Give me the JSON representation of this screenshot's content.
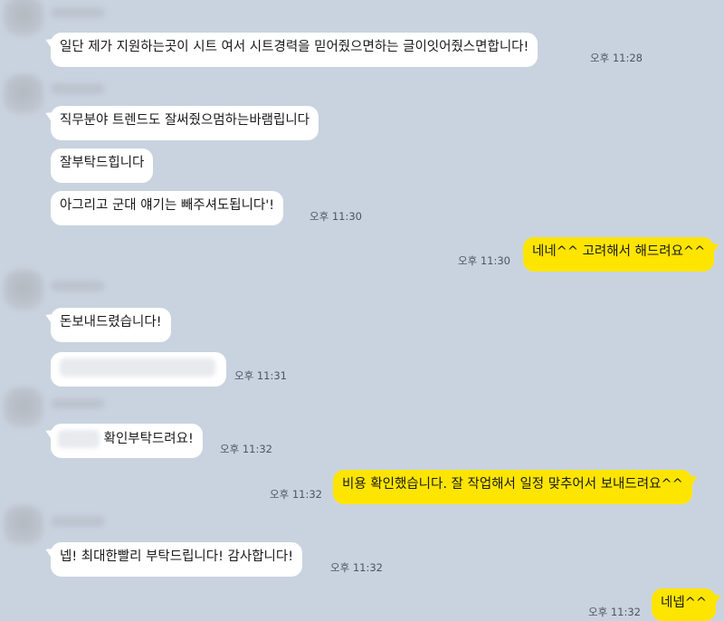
{
  "messages": [
    {
      "text": "일단 제가 지원하는곳이 시트 여서 시트경력을 믿어줬으면하는 글이잇어줬스면합니다!",
      "time": "오후 11:28"
    },
    {
      "text": "직무분야 트렌드도 잘써줬으멈하는바램립니다"
    },
    {
      "text": "잘부탁드힙니다"
    },
    {
      "text": "아그리고 군대 얘기는 빼주셔도됩니다'!",
      "time": "오후 11:30"
    },
    {
      "text": "네네^^ 고려해서 해드려요^^",
      "time": "오후 11:30"
    },
    {
      "text": "돈보내드렸습니다!"
    },
    {
      "text": "",
      "time": "오후 11:31"
    },
    {
      "text": "확인부탁드려요!",
      "time": "오후 11:32"
    },
    {
      "text": "비용 확인했습니다. 잘 작업해서 일정 맞추어서 보내드려요^^",
      "time": "오후 11:32"
    },
    {
      "text": "넵! 최대한빨리 부탁드립니다! 감사합니다!",
      "time": "오후 11:32"
    },
    {
      "text": "네넵^^",
      "time": "오후 11:32"
    }
  ],
  "colors": {
    "background": "#c9d3df",
    "incoming_bubble": "#ffffff",
    "outgoing_bubble": "#fee500",
    "timestamp": "#4d5560"
  }
}
